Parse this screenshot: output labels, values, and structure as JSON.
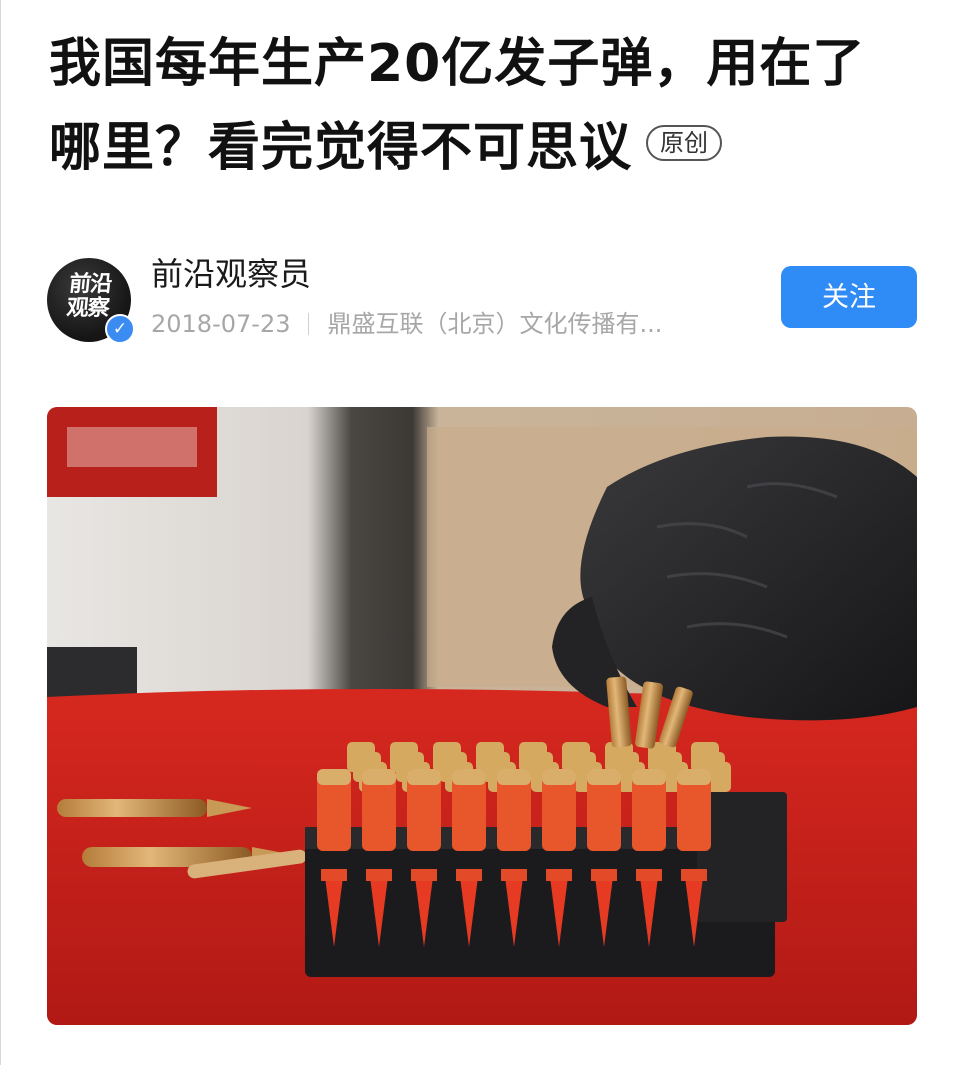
{
  "article": {
    "title": "我国每年生产20亿发子弹，用在了哪里？看完觉得不可思议",
    "badge": "原创"
  },
  "author": {
    "avatar_text_line1": "前沿",
    "avatar_text_line2": "观察",
    "name": "前沿观察员",
    "date": "2018-07-23",
    "source": "鼎盛互联（北京）文化传播有...",
    "verified_icon": "verified-check-icon",
    "follow_label": "关注"
  },
  "image": {
    "description_icon": "photo-of-bullets-in-loading-block"
  },
  "colors": {
    "accent": "#2f8bf6",
    "verified": "#3b8cf2",
    "meta_text": "#a7a7a7",
    "table_red": "#c8201c"
  }
}
